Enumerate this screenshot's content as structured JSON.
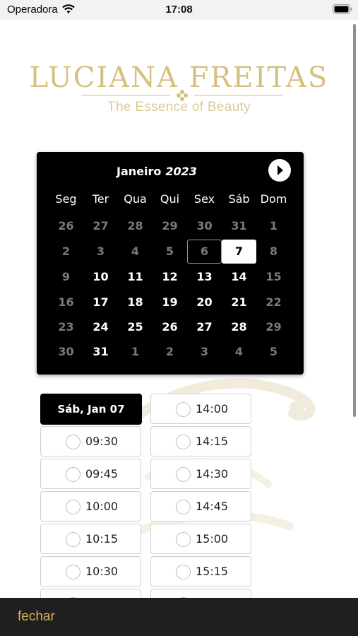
{
  "status_bar": {
    "carrier": "Operadora",
    "time": "17:08"
  },
  "logo": {
    "title": "LUCIANA FREITAS",
    "subtitle": "The Essence of Beauty"
  },
  "calendar": {
    "month": "Janeiro",
    "year": "2023",
    "weekdays": [
      "Seg",
      "Ter",
      "Qua",
      "Qui",
      "Sex",
      "Sáb",
      "Dom"
    ],
    "weeks": [
      [
        {
          "d": "26",
          "muted": true
        },
        {
          "d": "27",
          "muted": true
        },
        {
          "d": "28",
          "muted": true
        },
        {
          "d": "29",
          "muted": true
        },
        {
          "d": "30",
          "muted": true
        },
        {
          "d": "31",
          "muted": true
        },
        {
          "d": "1",
          "muted": true
        }
      ],
      [
        {
          "d": "2",
          "muted": true
        },
        {
          "d": "3",
          "muted": true
        },
        {
          "d": "4",
          "muted": true
        },
        {
          "d": "5",
          "muted": true
        },
        {
          "d": "6",
          "muted": true,
          "today": true
        },
        {
          "d": "7",
          "selected": true
        },
        {
          "d": "8",
          "muted": true
        }
      ],
      [
        {
          "d": "9",
          "muted": true
        },
        {
          "d": "10"
        },
        {
          "d": "11"
        },
        {
          "d": "12"
        },
        {
          "d": "13"
        },
        {
          "d": "14"
        },
        {
          "d": "15",
          "muted": true
        }
      ],
      [
        {
          "d": "16",
          "muted": true
        },
        {
          "d": "17"
        },
        {
          "d": "18"
        },
        {
          "d": "19"
        },
        {
          "d": "20"
        },
        {
          "d": "21"
        },
        {
          "d": "22",
          "muted": true
        }
      ],
      [
        {
          "d": "23",
          "muted": true
        },
        {
          "d": "24"
        },
        {
          "d": "25"
        },
        {
          "d": "26"
        },
        {
          "d": "27"
        },
        {
          "d": "28"
        },
        {
          "d": "29",
          "muted": true
        }
      ],
      [
        {
          "d": "30",
          "muted": true
        },
        {
          "d": "31"
        },
        {
          "d": "1",
          "muted": true
        },
        {
          "d": "2",
          "muted": true
        },
        {
          "d": "3",
          "muted": true
        },
        {
          "d": "4",
          "muted": true
        },
        {
          "d": "5",
          "muted": true
        }
      ]
    ]
  },
  "schedule": {
    "selected_date": "Sáb, Jan 07",
    "left_slots": [
      "09:30",
      "09:45",
      "10:00",
      "10:15",
      "10:30"
    ],
    "right_slots": [
      "14:00",
      "14:15",
      "14:30",
      "14:45",
      "15:00",
      "15:15"
    ]
  },
  "footer": {
    "close_label": "fechar"
  },
  "colors": {
    "gold": "#d6c07e",
    "accent": "#d7b35a",
    "calendar_bg": "#000000"
  }
}
